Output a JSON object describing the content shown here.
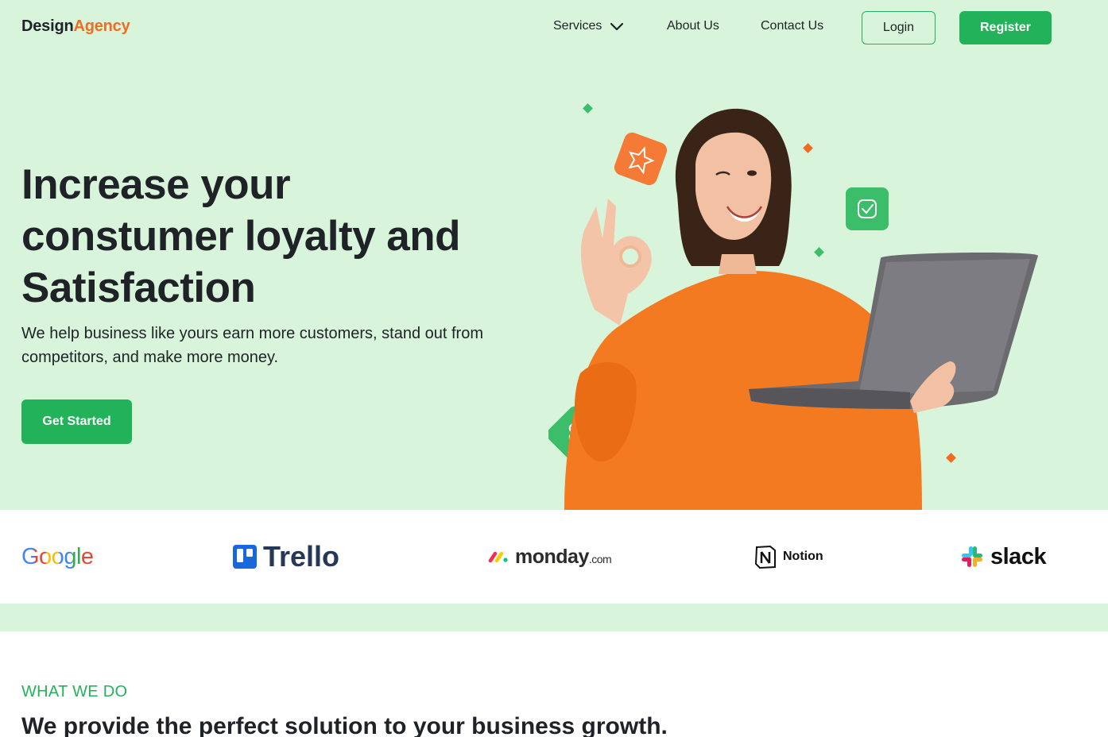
{
  "nav": {
    "logo_part1": "Design",
    "logo_part2": "Agency",
    "links": [
      {
        "label": "Services"
      },
      {
        "label": "About Us"
      },
      {
        "label": "Contact Us"
      }
    ],
    "login": "Login",
    "register": "Register"
  },
  "hero": {
    "title_line1": "Increase your",
    "title_line2": "constumer loyalty and",
    "title_line3": "Satisfaction",
    "subtitle": "We help business like yours earn more customers, stand out from competitors, and make more money.",
    "cta": "Get Started"
  },
  "brands": {
    "google": "Google",
    "trello": "Trello",
    "monday": "monday",
    "monday_suffix": ".com",
    "notion": "Notion",
    "slack": "slack"
  },
  "section": {
    "eyebrow": "WHAT WE DO",
    "title": "We provide the perfect solution to your business growth."
  },
  "colors": {
    "accent_green": "#22b35a",
    "brand_orange": "#f26b21",
    "hero_bg": "#d8f5dc"
  }
}
